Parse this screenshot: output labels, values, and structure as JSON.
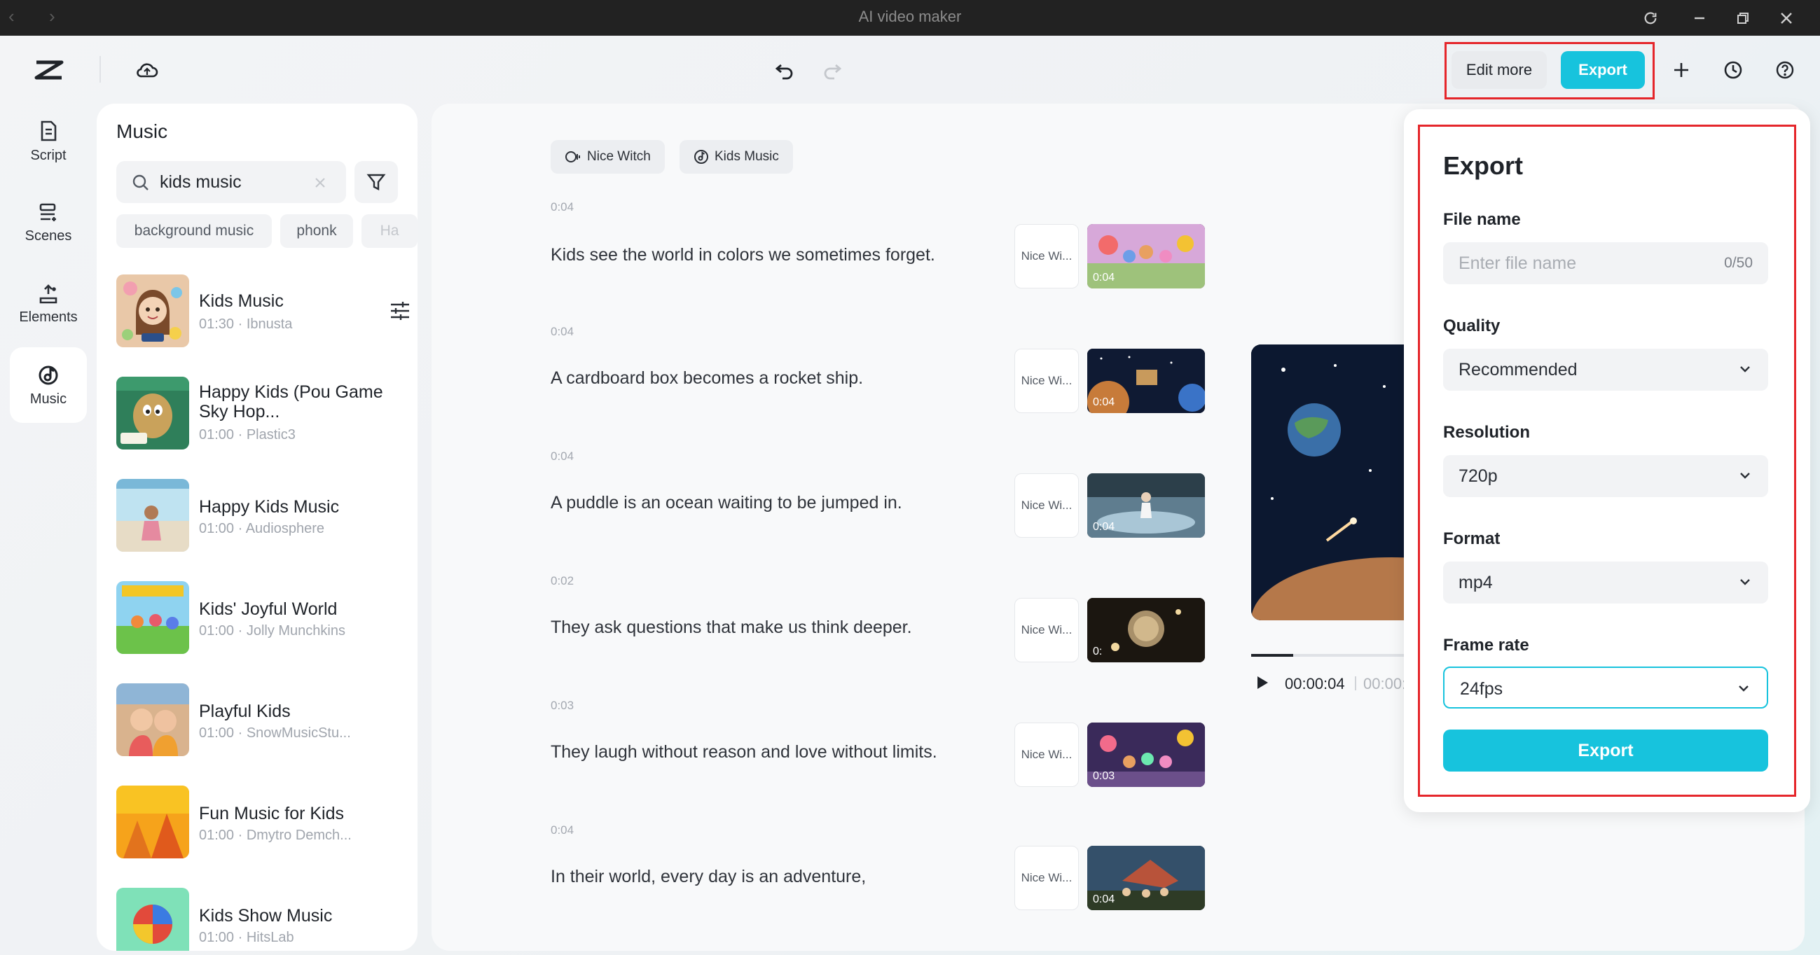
{
  "window": {
    "title": "AI video maker"
  },
  "rail": {
    "items": [
      {
        "label": "Script",
        "icon": "script-icon"
      },
      {
        "label": "Scenes",
        "icon": "scenes-icon"
      },
      {
        "label": "Elements",
        "icon": "elements-icon"
      },
      {
        "label": "Music",
        "icon": "music-icon",
        "active": true
      }
    ]
  },
  "music": {
    "title": "Music",
    "search_value": "kids music",
    "chips": [
      "background music",
      "phonk",
      "Ha"
    ],
    "tracks": [
      {
        "name": "Kids Music",
        "meta": "01:30 · Ibnusta"
      },
      {
        "name": "Happy Kids (Pou Game Sky Hop...",
        "meta": "01:00 · Plastic3"
      },
      {
        "name": "Happy Kids Music",
        "meta": "01:00 · Audiosphere"
      },
      {
        "name": "Kids' Joyful World",
        "meta": "01:00 · Jolly Munchkins"
      },
      {
        "name": "Playful Kids",
        "meta": "01:00 · SnowMusicStu..."
      },
      {
        "name": "Fun Music for Kids",
        "meta": "01:00 · Dmytro Demch..."
      },
      {
        "name": "Kids Show Music",
        "meta": "01:00 · HitsLab"
      }
    ]
  },
  "script": {
    "voice_tag": "Nice Witch",
    "music_tag": "Kids Music",
    "lines": [
      {
        "duration": "0:04",
        "text": "Kids see the world in colors we sometimes forget.",
        "voice": "Nice Wi...",
        "thumb_duration": "0:04"
      },
      {
        "duration": "0:04",
        "text": "A cardboard box becomes a rocket ship.",
        "voice": "Nice Wi...",
        "thumb_duration": "0:04"
      },
      {
        "duration": "0:04",
        "text": "A puddle is an ocean waiting to be jumped in.",
        "voice": "Nice Wi...",
        "thumb_duration": "0:04"
      },
      {
        "duration": "0:02",
        "text": "They ask questions that make us think deeper.",
        "voice": "Nice Wi...",
        "thumb_duration": "0:"
      },
      {
        "duration": "0:03",
        "text": "They laugh without reason and love without limits.",
        "voice": "Nice Wi...",
        "thumb_duration": "0:03"
      },
      {
        "duration": "0:04",
        "text": "In their world, every day is an adventure,",
        "voice": "Nice Wi...",
        "thumb_duration": "0:04"
      }
    ]
  },
  "preview": {
    "current_time": "00:00:04",
    "total_time": "00:00:",
    "progress": 0.25
  },
  "header": {
    "edit_more": "Edit more",
    "export": "Export"
  },
  "export_panel": {
    "title": "Export",
    "file_name_label": "File name",
    "file_name_placeholder": "Enter file name",
    "file_name_count": "0/50",
    "quality_label": "Quality",
    "quality_value": "Recommended",
    "resolution_label": "Resolution",
    "resolution_value": "720p",
    "format_label": "Format",
    "format_value": "mp4",
    "frame_rate_label": "Frame rate",
    "frame_rate_value": "24fps",
    "export_button": "Export"
  },
  "colors": {
    "accent": "#17c3dd",
    "highlight": "#e5262b"
  }
}
